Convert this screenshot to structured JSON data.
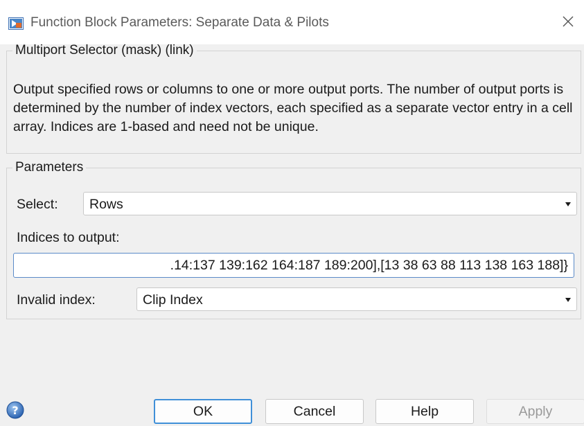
{
  "window": {
    "title": "Function Block Parameters: Separate Data & Pilots"
  },
  "mask": {
    "legend": "Multiport Selector (mask) (link)",
    "description": "Output specified rows or columns to one or more output ports.  The number of output ports is determined by the number of index vectors, each specified as a separate vector entry in a cell array. Indices are 1-based and need not be unique."
  },
  "parameters": {
    "legend": "Parameters",
    "select": {
      "label": "Select:",
      "value": "Rows"
    },
    "indices": {
      "label": "Indices to output:",
      "value": ".14:137 139:162 164:187 189:200],[13 38 63 88 113 138 163 188]}"
    },
    "invalid_index": {
      "label": "Invalid index:",
      "value": "Clip Index"
    }
  },
  "buttons": {
    "ok": "OK",
    "cancel": "Cancel",
    "help": "Help",
    "apply": "Apply"
  },
  "icons": {
    "app": "simulink-block-icon",
    "close": "close-icon",
    "help": "help-question-icon"
  },
  "colors": {
    "focus_accent": "#3f8fd8",
    "disabled_text": "#9a9a9a"
  }
}
